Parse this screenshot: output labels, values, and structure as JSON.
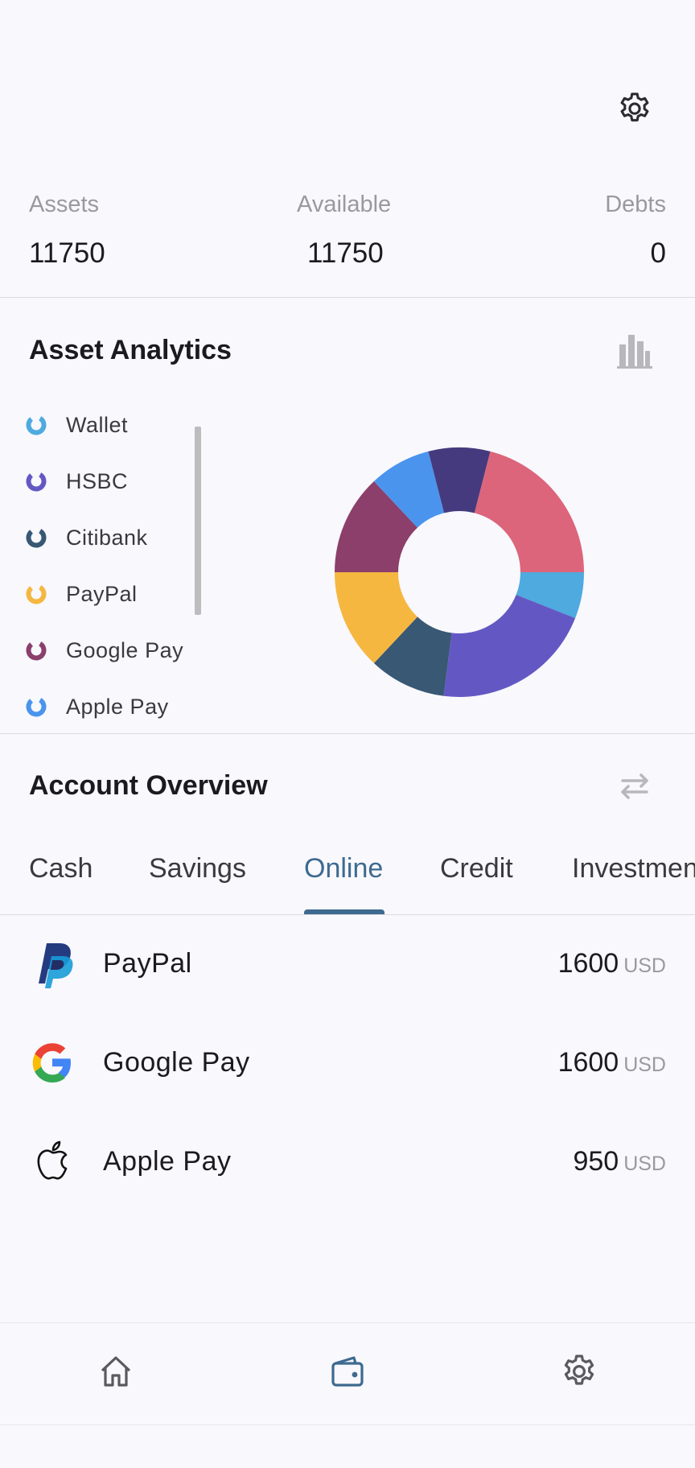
{
  "summary": {
    "assets_label": "Assets",
    "assets_value": "11750",
    "available_label": "Available",
    "available_value": "11750",
    "debts_label": "Debts",
    "debts_value": "0"
  },
  "analytics": {
    "title": "Asset Analytics",
    "legend": [
      {
        "label": "Wallet",
        "color": "#4eaadf"
      },
      {
        "label": "HSBC",
        "color": "#6358c3"
      },
      {
        "label": "Citibank",
        "color": "#385874"
      },
      {
        "label": "PayPal",
        "color": "#f5b740"
      },
      {
        "label": "Google Pay",
        "color": "#8b3f6a"
      },
      {
        "label": "Apple Pay",
        "color": "#4a94ee"
      }
    ]
  },
  "chart_data": {
    "type": "pie",
    "variant": "donut",
    "slices": [
      {
        "color": "#4eaadf",
        "value": 6
      },
      {
        "color": "#6358c3",
        "value": 21
      },
      {
        "color": "#385874",
        "value": 10
      },
      {
        "color": "#f5b740",
        "value": 13
      },
      {
        "color": "#8b3f6a",
        "value": 13
      },
      {
        "color": "#4a94ee",
        "value": 8
      },
      {
        "color": "#463a7e",
        "value": 8
      },
      {
        "color": "#dc657b",
        "value": 21
      }
    ]
  },
  "overview": {
    "title": "Account Overview",
    "tabs": [
      {
        "label": "Cash"
      },
      {
        "label": "Savings"
      },
      {
        "label": "Online"
      },
      {
        "label": "Credit"
      },
      {
        "label": "Investmen"
      }
    ],
    "active_tab": "Online",
    "accounts": [
      {
        "name": "PayPal",
        "value": "1600",
        "currency": "USD",
        "icon": "paypal-logo"
      },
      {
        "name": "Google Pay",
        "value": "1600",
        "currency": "USD",
        "icon": "google-logo"
      },
      {
        "name": "Apple Pay",
        "value": "950",
        "currency": "USD",
        "icon": "apple-logo"
      }
    ]
  },
  "colors": {
    "accent": "#3e6a8f",
    "muted": "#9a9a9e",
    "background": "#f8f8fd"
  },
  "nav": {
    "items": [
      {
        "icon": "home-icon"
      },
      {
        "icon": "wallet-icon"
      },
      {
        "icon": "gear-icon"
      }
    ],
    "active": "wallet-icon"
  }
}
